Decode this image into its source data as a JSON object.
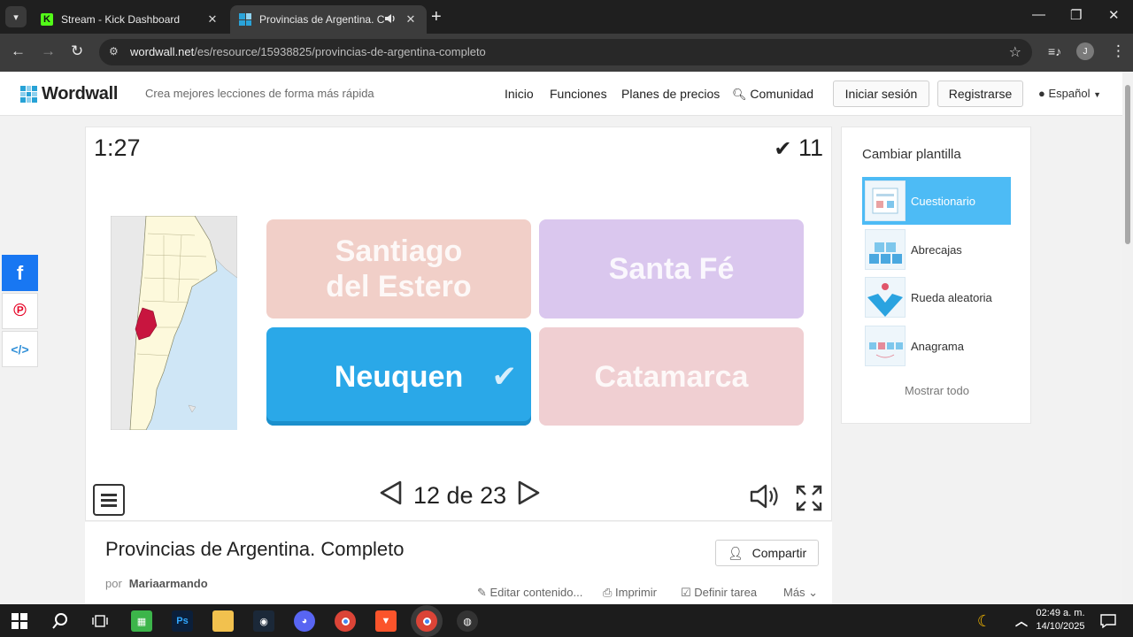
{
  "browser": {
    "tabs": [
      {
        "title": "Stream - Kick Dashboard"
      },
      {
        "title": "Provincias de Argentina. Co"
      }
    ],
    "url_host": "wordwall.net",
    "url_path": "/es/resource/15938825/provincias-de-argentina-completo",
    "profile_initial": "J"
  },
  "site": {
    "logo": "Wordwall",
    "tagline": "Crea mejores lecciones de forma más rápida",
    "nav": [
      "Inicio",
      "Funciones",
      "Planes de precios",
      "Comunidad"
    ],
    "login": "Iniciar sesión",
    "register": "Registrarse",
    "language": "Español"
  },
  "game": {
    "timer": "1:27",
    "score": "11",
    "answers": [
      {
        "line1": "Santiago",
        "line2": "del Estero"
      },
      {
        "line1": "Santa Fé",
        "line2": ""
      },
      {
        "line1": "Neuquen",
        "line2": ""
      },
      {
        "line1": "Catamarca",
        "line2": ""
      }
    ],
    "pager": "12 de 23"
  },
  "activity": {
    "title": "Provincias de Argentina. Completo",
    "share": "Compartir",
    "by": "por",
    "author": "Mariaarmando",
    "actions": [
      "Editar contenido...",
      "Imprimir",
      "Definir tarea",
      "Más"
    ]
  },
  "templates": {
    "heading": "Cambiar plantilla",
    "items": [
      "Cuestionario",
      "Abrecajas",
      "Rueda aleatoria",
      "Anagrama"
    ],
    "show_all": "Mostrar todo"
  },
  "taskbar": {
    "time": "02:49 a. m.",
    "date": "14/10/2025"
  },
  "colors": {
    "selected_answer": "#2aa8e8",
    "active_template": "#4dbbf5",
    "highlight_province": "#c8153f"
  }
}
